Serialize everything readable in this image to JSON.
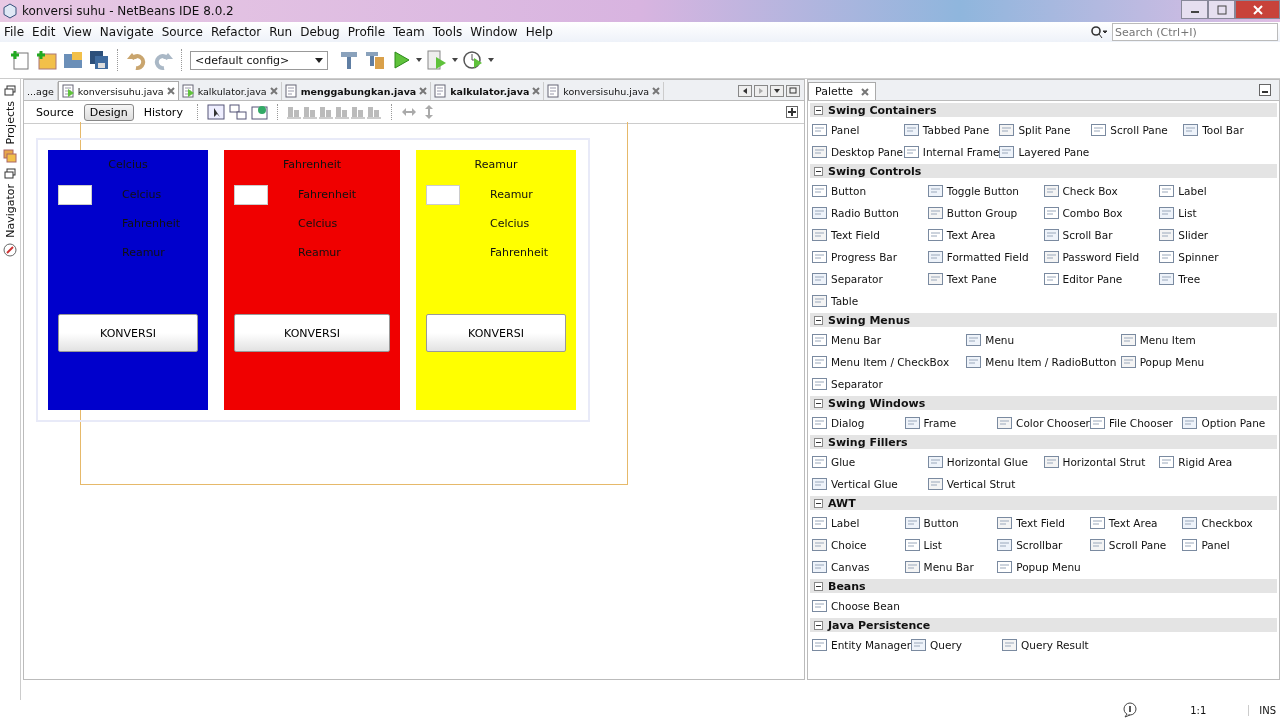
{
  "window": {
    "title": "konversi suhu - NetBeans IDE 8.0.2"
  },
  "menu": [
    "File",
    "Edit",
    "View",
    "Navigate",
    "Source",
    "Refactor",
    "Run",
    "Debug",
    "Profile",
    "Team",
    "Tools",
    "Window",
    "Help"
  ],
  "toolbar": {
    "config": "<default config>"
  },
  "search": {
    "placeholder": "Search (Ctrl+I)"
  },
  "side_tabs": [
    "Projects",
    "Navigator"
  ],
  "editor_tabs": [
    {
      "label": "...age",
      "selected": false,
      "modified": false
    },
    {
      "label": "konversisuhu.java",
      "selected": true,
      "modified": false
    },
    {
      "label": "kalkulator.java",
      "selected": false,
      "modified": false
    },
    {
      "label": "menggabungkan.java",
      "selected": false,
      "modified": true
    },
    {
      "label": "kalkulator.java",
      "selected": false,
      "modified": true
    },
    {
      "label": "konversisuhu.java",
      "selected": false,
      "modified": false
    }
  ],
  "view_tabs": [
    {
      "label": "Source",
      "selected": false
    },
    {
      "label": "Design",
      "selected": true
    },
    {
      "label": "History",
      "selected": false
    }
  ],
  "form_panels": [
    {
      "color": "#0000cc",
      "title": "Celcius",
      "labels": [
        "Celcius",
        "Fahrenheit",
        "Reamur"
      ],
      "button": "KONVERSI"
    },
    {
      "color": "#f00000",
      "title": "Fahrenheit",
      "labels": [
        "Fahrenheit",
        "Celcius",
        "Reamur"
      ],
      "button": "KONVERSI"
    },
    {
      "color": "#ffff00",
      "title": "Reamur",
      "labels": [
        "Reamur",
        "Celcius",
        "Fahrenheit"
      ],
      "button": "KONVERSI"
    }
  ],
  "palette": {
    "title": "Palette",
    "sections": [
      {
        "name": "Swing Containers",
        "expanded": true,
        "items": [
          "Panel",
          "Tabbed Pane",
          "Split Pane",
          "Scroll Pane",
          "Tool Bar",
          "Desktop Pane",
          "Internal Frame",
          "Layered Pane"
        ]
      },
      {
        "name": "Swing Controls",
        "expanded": true,
        "items": [
          "Button",
          "Toggle Button",
          "Check Box",
          "Label",
          "Radio Button",
          "Button Group",
          "Combo Box",
          "List",
          "Text Field",
          "Text Area",
          "Scroll Bar",
          "Slider",
          "Progress Bar",
          "Formatted Field",
          "Password Field",
          "Spinner",
          "Separator",
          "Text Pane",
          "Editor Pane",
          "Tree",
          "Table"
        ]
      },
      {
        "name": "Swing Menus",
        "expanded": true,
        "items": [
          "Menu Bar",
          "Menu",
          "Menu Item",
          "Menu Item / CheckBox",
          "Menu Item / RadioButton",
          "Popup Menu",
          "Separator"
        ]
      },
      {
        "name": "Swing Windows",
        "expanded": true,
        "items": [
          "Dialog",
          "Frame",
          "Color Chooser",
          "File Chooser",
          "Option Pane"
        ]
      },
      {
        "name": "Swing Fillers",
        "expanded": true,
        "items": [
          "Glue",
          "Horizontal Glue",
          "Horizontal Strut",
          "Rigid Area",
          "Vertical Glue",
          "Vertical Strut"
        ]
      },
      {
        "name": "AWT",
        "expanded": true,
        "items": [
          "Label",
          "Button",
          "Text Field",
          "Text Area",
          "Checkbox",
          "Choice",
          "List",
          "Scrollbar",
          "Scroll Pane",
          "Panel",
          "Canvas",
          "Menu Bar",
          "Popup Menu"
        ]
      },
      {
        "name": "Beans",
        "expanded": true,
        "items": [
          "Choose Bean"
        ]
      },
      {
        "name": "Java Persistence",
        "expanded": true,
        "items": [
          "Entity Manager",
          "Query",
          "Query Result"
        ]
      }
    ]
  },
  "status_bar": {
    "position": "1:1",
    "mode": "INS"
  }
}
